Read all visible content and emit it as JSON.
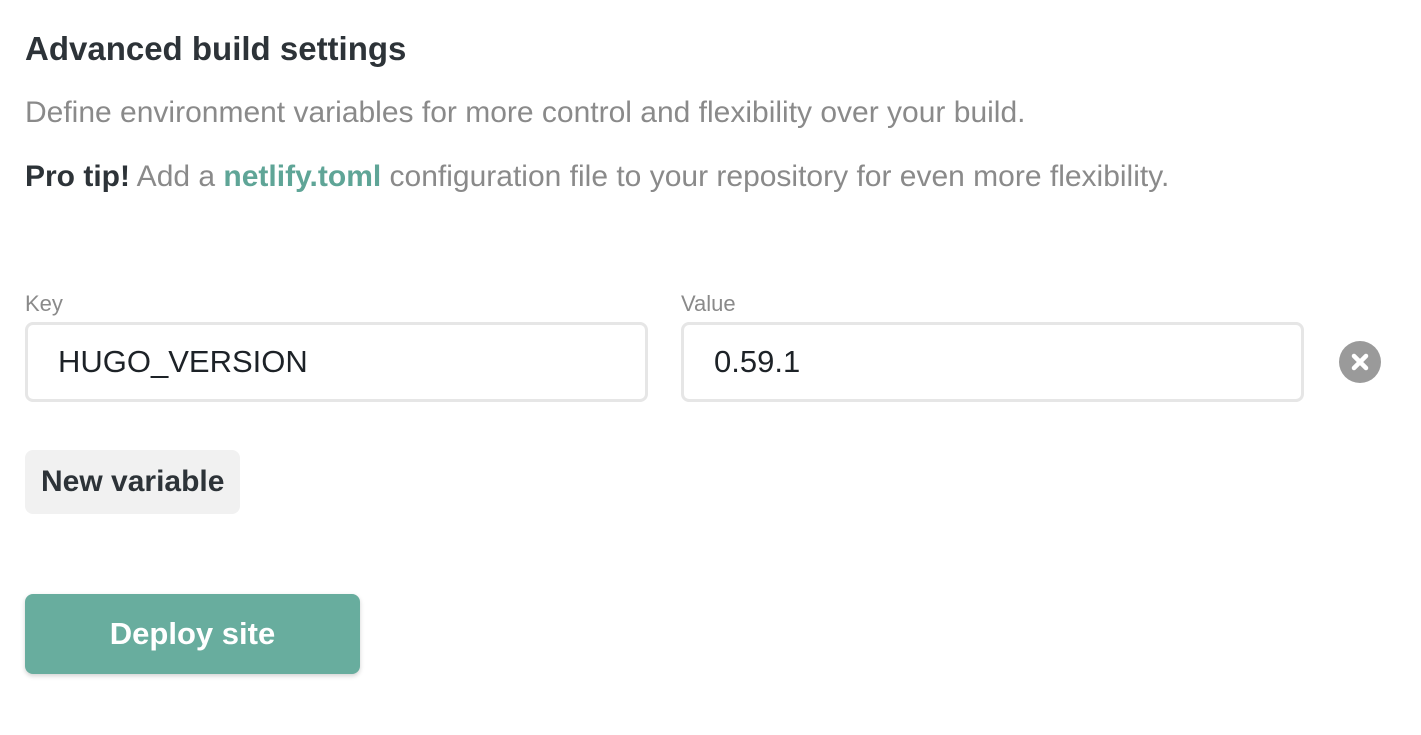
{
  "section": {
    "title": "Advanced build settings",
    "description": "Define environment variables for more control and flexibility over your build.",
    "tip": {
      "lead": "Pro tip!",
      "before_link": " Add a ",
      "link": "netlify.toml",
      "after_link": " configuration file to your repository for even more flexibility."
    }
  },
  "env_variable": {
    "key_label": "Key",
    "key_value": "HUGO_VERSION",
    "value_label": "Value",
    "value_value": "0.59.1",
    "remove_icon": "close-circle-icon"
  },
  "actions": {
    "new_variable_label": "New variable",
    "deploy_label": "Deploy site"
  },
  "colors": {
    "accent": "#68ad9e",
    "link": "#5fa597",
    "muted_text": "#8a8a8a",
    "heading_text": "#2d3338",
    "secondary_button_bg": "#f1f1f1",
    "remove_icon_bg": "#9a9a9a"
  }
}
